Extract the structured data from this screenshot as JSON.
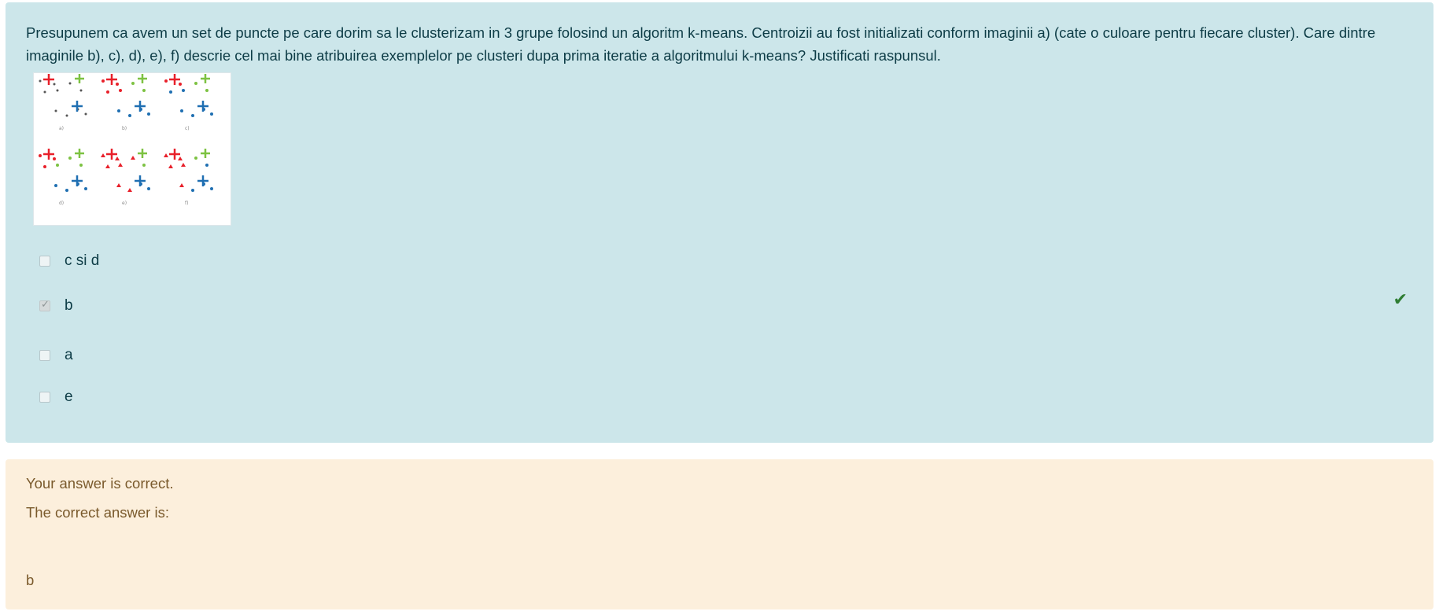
{
  "question": {
    "text": "Presupunem ca avem un set de puncte pe care dorim sa le clusterizam in 3 grupe folosind un algoritm k-means. Centroizii au fost initializati conform imaginii a) (cate o culoare pentru fiecare cluster). Care dintre imaginile b), c), d), e), f) descrie cel mai bine atribuirea exemplelor pe clusteri dupa prima iteratie a algoritmului k-means? Justificati raspunsul.",
    "image_panel_labels": [
      "a)",
      "b)",
      "c)",
      "d)",
      "e)",
      "f)"
    ],
    "options": [
      {
        "label": "c si d",
        "checked": false
      },
      {
        "label": "b",
        "checked": true
      },
      {
        "label": "a",
        "checked": false
      },
      {
        "label": "e",
        "checked": false
      }
    ],
    "correct_icon": "check-icon"
  },
  "feedback": {
    "result": "Your answer is correct.",
    "correct_intro": "The correct answer is:",
    "correct_answer": "b"
  },
  "colors": {
    "question_bg": "#cce6ea",
    "feedback_bg": "#fcefdc",
    "check_green": "#2e7d32",
    "cluster_red": "#e8202a",
    "cluster_green": "#7dc242",
    "cluster_blue": "#1f6fb2"
  }
}
